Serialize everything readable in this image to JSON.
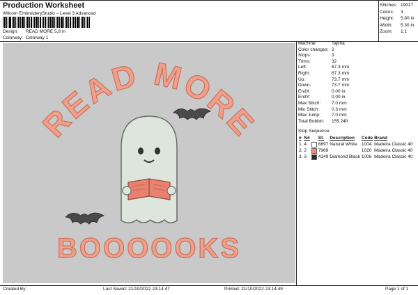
{
  "header": {
    "title": "Production Worksheet",
    "subtitle": "Wilcom EmbroideryStudio – Level 3 Advanced",
    "design_label": "Design:",
    "design_value": "READ MORE 5,8 in",
    "colorway_label": "Colorway:",
    "colorway_value": "Colorway 1"
  },
  "stats": [
    {
      "label": "Stitches:",
      "value": "19017"
    },
    {
      "label": "Colors:",
      "value": "3"
    },
    {
      "label": "Height:",
      "value": "5.80 in"
    },
    {
      "label": "Width:",
      "value": "5.30 in"
    },
    {
      "label": "Zoom:",
      "value": "1:1"
    }
  ],
  "design": {
    "top_text": "READ MORE",
    "bottom_text": "BOOOOOKS",
    "colors": {
      "background": "#c9c9c9",
      "lettering": "#f0a08a",
      "ghost": "#dde5dc",
      "bat": "#4a4a4a",
      "book": "#e8826e"
    }
  },
  "machine_info": [
    {
      "label": "Machine:",
      "value": "Tajima"
    },
    {
      "label": "Color changes:",
      "value": "2"
    },
    {
      "label": "Stops:",
      "value": "3"
    },
    {
      "label": "Trims:",
      "value": "32"
    },
    {
      "label": "Left:",
      "value": "67.3 mm"
    },
    {
      "label": "Right:",
      "value": "67.3 mm"
    },
    {
      "label": "Up:",
      "value": "73.7 mm"
    },
    {
      "label": "Down:",
      "value": "73.7 mm"
    },
    {
      "label": "EndX:",
      "value": "0.00 in"
    },
    {
      "label": "EndY:",
      "value": "0.00 in"
    },
    {
      "label": "Max Stitch:",
      "value": "7.0 mm"
    },
    {
      "label": "Min Stitch:",
      "value": "0.3 mm"
    },
    {
      "label": "Max Jump:",
      "value": "7.0 mm"
    },
    {
      "label": "Total Bobbin:",
      "value": "155.24ft"
    }
  ],
  "stop_sequence": {
    "title": "Stop Sequence:",
    "columns": [
      "#",
      "N#",
      "St.",
      "Description",
      "Code",
      "Brand"
    ],
    "rows": [
      {
        "idx": "1.",
        "needle": "4",
        "color": "#ffffff",
        "st": "6897",
        "desc": "Natural White",
        "code": "1004",
        "brand": "Madeira Classic 40"
      },
      {
        "idx": "2.",
        "needle": "2",
        "color": "#f08a75",
        "st": "7969",
        "desc": "",
        "code": "1020",
        "brand": "Madeira Classic 40"
      },
      {
        "idx": "3.",
        "needle": "3",
        "color": "#2a2a2a",
        "st": "4149",
        "desc": "Diamond Black",
        "code": "1006",
        "brand": "Madeira Classic 40"
      }
    ]
  },
  "footer": {
    "created_by": "Created By:",
    "last_saved": "Last Saved: 21/10/2022 23:14:47",
    "printed": "Printed: 21/10/2022 23:14:49",
    "page": "Page 1 of 1"
  }
}
